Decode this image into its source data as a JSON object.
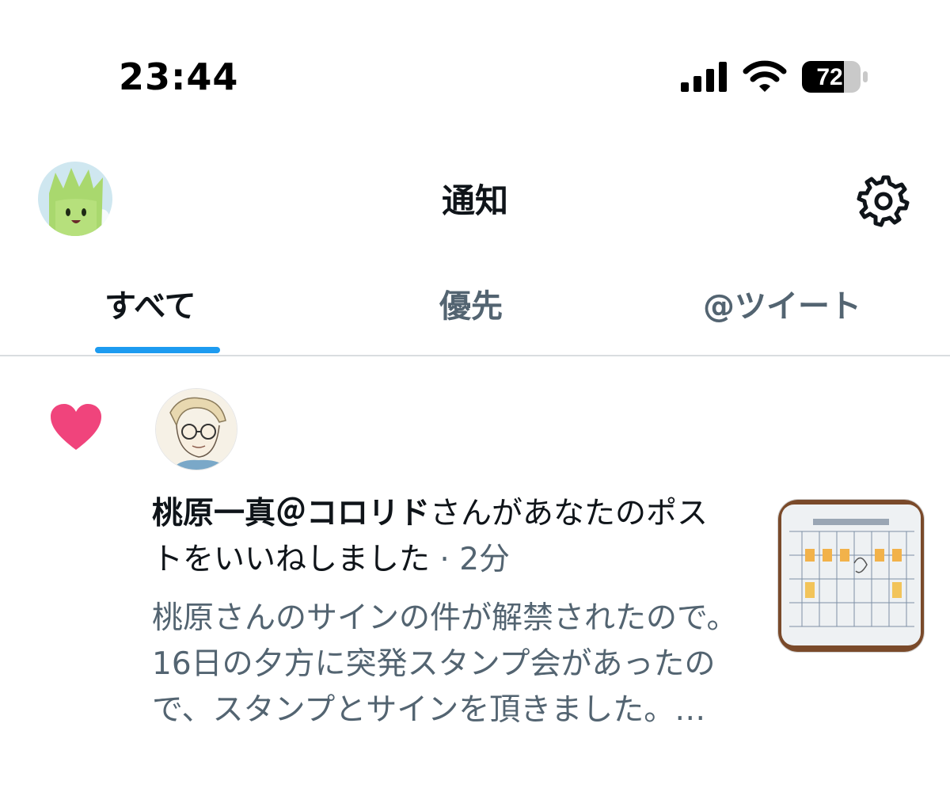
{
  "status_bar": {
    "time": "23:44",
    "battery_level": "72",
    "icons": [
      "signal-icon",
      "wifi-icon",
      "battery-icon"
    ]
  },
  "header": {
    "title": "通知",
    "avatar_icon": "profile-avatar",
    "settings_icon": "gear-icon"
  },
  "tabs": [
    {
      "label": "すべて",
      "active": true
    },
    {
      "label": "優先",
      "active": false
    },
    {
      "label": "@ツイート",
      "active": false
    }
  ],
  "notification": {
    "type_icon": "heart-icon",
    "user_name": "桃原一真＠コロリド",
    "action_text": "さんがあなたのポストをいいねしました",
    "separator": "·",
    "time_ago": "2分",
    "post_preview": "桃原さんのサインの件が解禁されたので。16日の夕方に突発スタンプ会があったので、スタンプとサインを頂きました。…"
  },
  "colors": {
    "accent": "#1d9bf0",
    "like": "#f0447c",
    "secondary_text": "#536471",
    "primary_text": "#0f1419"
  }
}
